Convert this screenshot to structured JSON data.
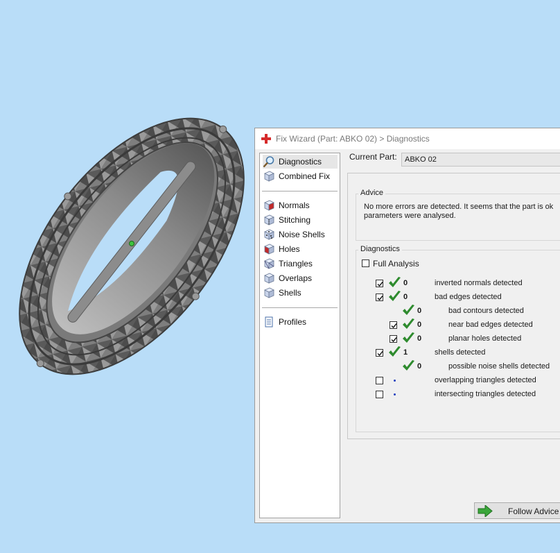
{
  "dialog": {
    "title": "Fix Wizard (Part: ABKO   02) > Diagnostics",
    "current_part_label": "Current Part:",
    "current_part_value": "ABKO   02"
  },
  "nav": {
    "top_items": [
      {
        "label": "Diagnostics",
        "icon": "magnifier-icon",
        "selected": true
      },
      {
        "label": "Combined Fix",
        "icon": "cube-icon"
      }
    ],
    "fix_items": [
      {
        "label": "Normals",
        "icon": "normals-cube-icon"
      },
      {
        "label": "Stitching",
        "icon": "stitching-cube-icon"
      },
      {
        "label": "Noise Shells",
        "icon": "noise-shells-icon"
      },
      {
        "label": "Holes",
        "icon": "holes-cube-icon"
      },
      {
        "label": "Triangles",
        "icon": "triangles-cube-icon"
      },
      {
        "label": "Overlaps",
        "icon": "overlaps-cube-icon"
      },
      {
        "label": "Shells",
        "icon": "shells-cube-icon"
      }
    ],
    "profiles_label": "Profiles"
  },
  "advice": {
    "title": "Advice",
    "line1": "No more errors are detected. It seems that the part is ok",
    "line2": "parameters were analysed."
  },
  "diagnostics": {
    "title": "Diagnostics",
    "full_analysis_label": "Full Analysis",
    "full_analysis_checked": false,
    "rows": [
      {
        "checkbox": true,
        "checked": true,
        "status": "ok",
        "count": "0",
        "label": "inverted normals detected",
        "indent": 0
      },
      {
        "checkbox": true,
        "checked": true,
        "status": "ok",
        "count": "0",
        "label": "bad edges detected",
        "indent": 0
      },
      {
        "checkbox": false,
        "checked": false,
        "status": "ok",
        "count": "0",
        "label": "bad contours detected",
        "indent": 1
      },
      {
        "checkbox": true,
        "checked": true,
        "status": "ok",
        "count": "0",
        "label": "near bad edges detected",
        "indent": 1
      },
      {
        "checkbox": true,
        "checked": true,
        "status": "ok",
        "count": "0",
        "label": "planar holes detected",
        "indent": 1
      },
      {
        "checkbox": true,
        "checked": true,
        "status": "ok",
        "count": "1",
        "label": "shells detected",
        "indent": 0
      },
      {
        "checkbox": false,
        "checked": false,
        "status": "ok",
        "count": "0",
        "label": "possible noise shells detected",
        "indent": 1
      },
      {
        "checkbox": true,
        "checked": false,
        "status": "pending",
        "count": "",
        "label": "overlapping triangles detected",
        "indent": 0
      },
      {
        "checkbox": true,
        "checked": false,
        "status": "pending",
        "count": "",
        "label": "intersecting triangles detected",
        "indent": 0
      }
    ]
  },
  "buttons": {
    "follow_advice": "Follow Advice"
  },
  "colors": {
    "background": "#b9ddf8",
    "check_green": "#2e8b2e",
    "arrow_green": "#3aa63a",
    "title_icon_red": "#d62a2a"
  }
}
